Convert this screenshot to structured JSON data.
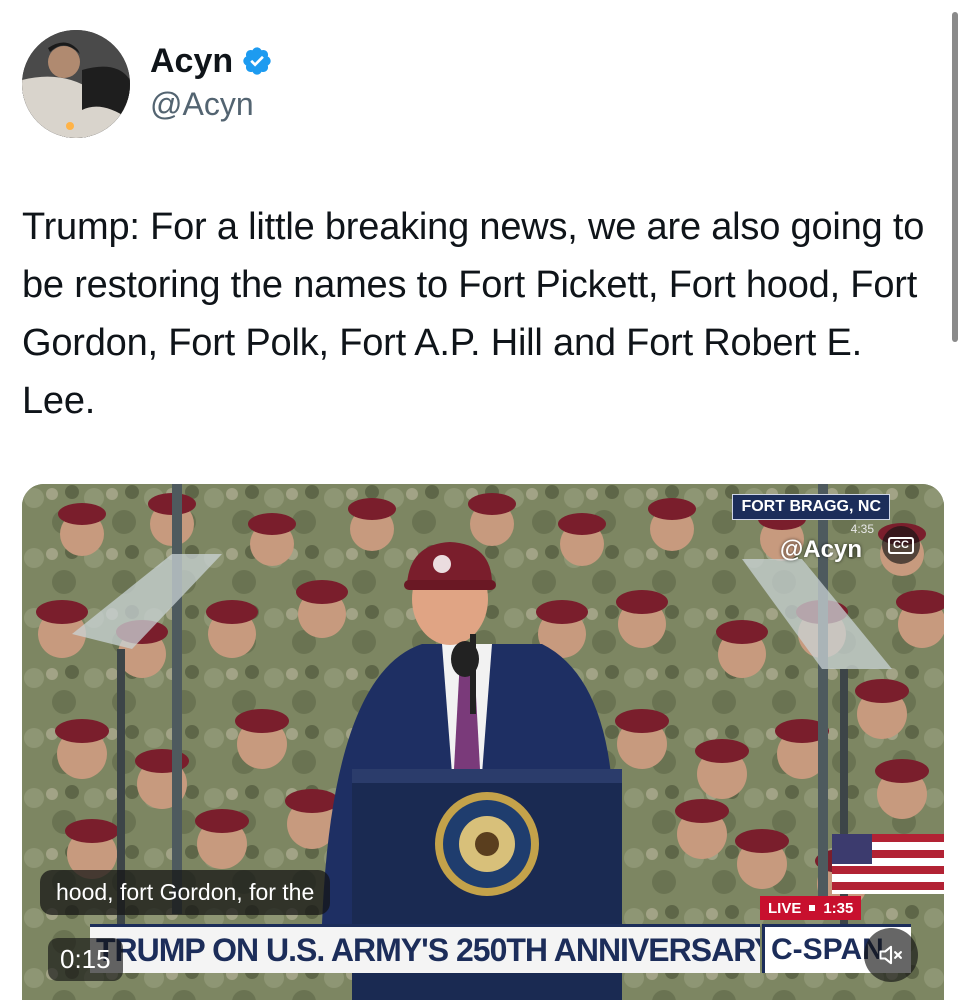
{
  "author": {
    "display_name": "Acyn",
    "handle": "@Acyn",
    "verified": true,
    "verified_color": "#1d9bf0"
  },
  "tweet": {
    "text": "Trump: For a little breaking news, we are also going to be restoring the names to Fort Pickett, Fort hood, Fort Gordon, Fort Polk, Fort A.P. Hill and Fort Robert E. Lee."
  },
  "video": {
    "location_bug": "FORT BRAGG, NC",
    "bug_time": "4:35",
    "watermark": "@Acyn",
    "captions_label": "CC",
    "caption_text": "hood, fort Gordon, for the",
    "live_label": "LIVE",
    "live_time": "1:35",
    "chyron": "TRUMP ON U.S. ARMY'S 250TH ANNIVERSARY",
    "network": "C-SPAN",
    "elapsed": "0:15",
    "muted": true
  },
  "colors": {
    "text_primary": "#0f1419",
    "text_secondary": "#536471",
    "chyron_navy": "#1c2d5a",
    "live_red": "#c8102e",
    "beret_maroon": "#7a1e2c",
    "camo": "#7d8662"
  },
  "icons": [
    "verified-badge-icon",
    "closed-captions-icon",
    "mute-icon",
    "presidential-seal-icon"
  ]
}
